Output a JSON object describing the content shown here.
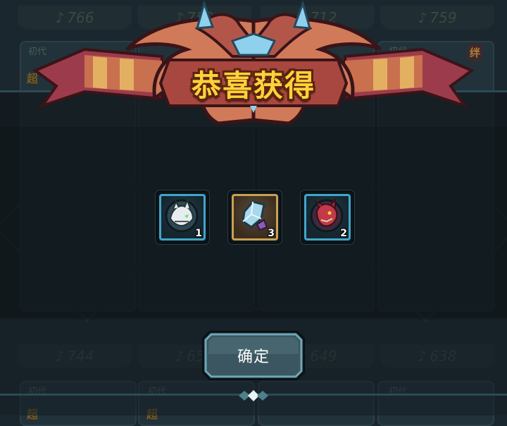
{
  "popup": {
    "title": "恭喜获得",
    "confirm_label": "确定"
  },
  "rewards": [
    {
      "name": "white-beast-egg",
      "quantity": "1",
      "frame": "blue"
    },
    {
      "name": "ice-crystal-shard",
      "quantity": "3",
      "frame": "gold"
    },
    {
      "name": "red-dragon-egg",
      "quantity": "2",
      "frame": "blue"
    }
  ],
  "background": {
    "top_powers": [
      "766",
      "753",
      "712",
      "759"
    ],
    "bottom_powers": [
      "744",
      "653",
      "649",
      "638"
    ],
    "generation_label": "初代",
    "bond_badge": "绊",
    "rank_label": "超"
  },
  "colors": {
    "title_fill": "#ffd23a",
    "title_outline": "#5a2410",
    "item_frame_blue": "#41a6c9",
    "item_frame_gold": "#c9a154",
    "button_border": "#6ea8b8"
  }
}
